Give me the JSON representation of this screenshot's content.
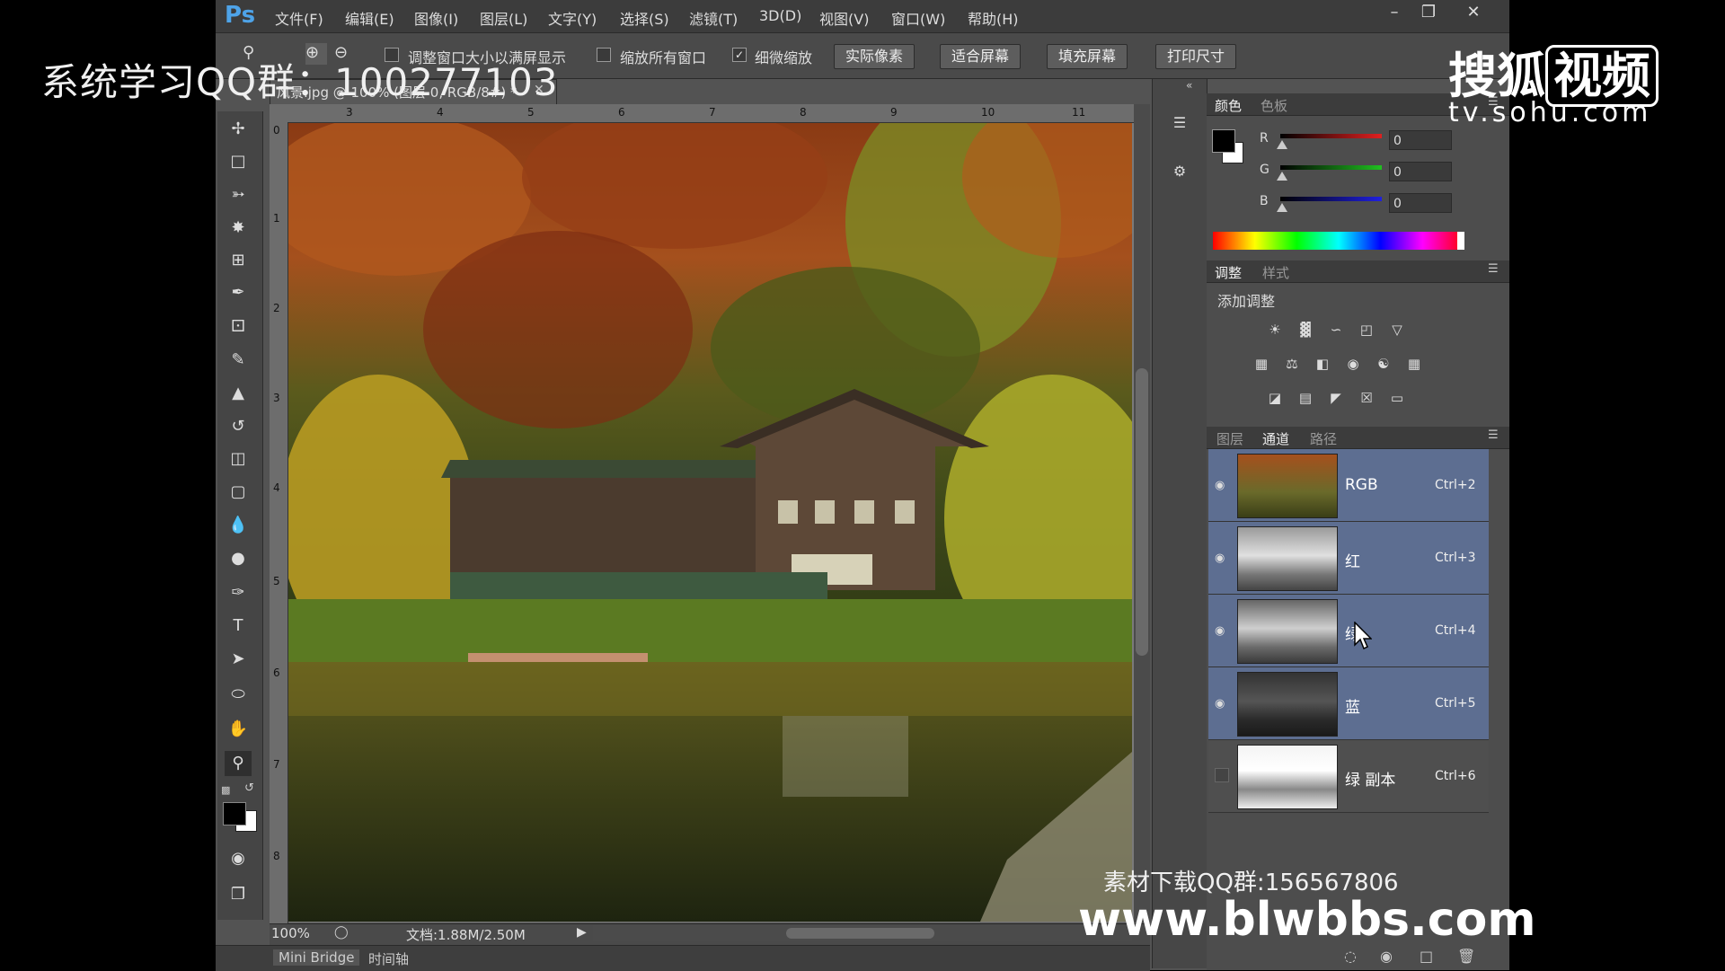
{
  "app": {
    "logo": "Ps",
    "menu": [
      "文件(F)",
      "编辑(E)",
      "图像(I)",
      "图层(L)",
      "文字(Y)",
      "选择(S)",
      "滤镜(T)",
      "3D(D)",
      "视图(V)",
      "窗口(W)",
      "帮助(H)"
    ],
    "window_buttons": [
      "minimize",
      "restore",
      "close"
    ]
  },
  "options_bar": {
    "checkbox_resize": {
      "label": "调整窗口大小以满屏显示",
      "checked": false
    },
    "checkbox_zoom_all": {
      "label": "缩放所有窗口",
      "checked": false
    },
    "checkbox_scrubby": {
      "label": "细微缩放",
      "checked": true
    },
    "buttons": [
      "实际像素",
      "适合屏幕",
      "填充屏幕",
      "打印尺寸"
    ]
  },
  "document": {
    "tab_title": "风景.jpg @ 100% (图层 0, RGB/8#) *",
    "ruler_h": [
      "3",
      "4",
      "5",
      "6",
      "7",
      "8",
      "9",
      "10",
      "11"
    ],
    "ruler_v": [
      "0",
      "1",
      "2",
      "3",
      "4",
      "5",
      "6",
      "7",
      "8"
    ],
    "zoom": "100%",
    "doc_size": "文档:1.88M/2.50M"
  },
  "bottom_tabs": [
    "Mini Bridge",
    "时间轴"
  ],
  "color_panel": {
    "tabs": [
      "颜色",
      "色板"
    ],
    "channels": [
      {
        "label": "R",
        "value": "0",
        "color": "#e02020"
      },
      {
        "label": "G",
        "value": "0",
        "color": "#20c020"
      },
      {
        "label": "B",
        "value": "0",
        "color": "#2020e0"
      }
    ]
  },
  "adjustments_panel": {
    "tabs": [
      "调整",
      "样式"
    ],
    "title": "添加调整",
    "icon_rows": [
      [
        "brightness-icon",
        "levels-icon",
        "curves-icon",
        "exposure-icon",
        "vibrance-icon"
      ],
      [
        "hue-saturation-icon",
        "color-balance-icon",
        "black-white-icon",
        "photo-filter-icon",
        "channel-mixer-icon",
        "color-lookup-icon"
      ],
      [
        "invert-icon",
        "posterize-icon",
        "threshold-icon",
        "selective-color-icon",
        "gradient-map-icon"
      ]
    ]
  },
  "channels_panel": {
    "tabs": [
      "图层",
      "通道",
      "路径"
    ],
    "active_tab": "通道",
    "rows": [
      {
        "name": "RGB",
        "shortcut": "Ctrl+2",
        "visible": true,
        "selected": true
      },
      {
        "name": "红",
        "shortcut": "Ctrl+3",
        "visible": true,
        "selected": true
      },
      {
        "name": "绿",
        "shortcut": "Ctrl+4",
        "visible": true,
        "selected": true
      },
      {
        "name": "蓝",
        "shortcut": "Ctrl+5",
        "visible": true,
        "selected": true
      },
      {
        "name": "绿 副本",
        "shortcut": "Ctrl+6",
        "visible": false,
        "selected": false
      }
    ]
  },
  "watermarks": {
    "left": "系统学习QQ群：100277103",
    "sohu_cn": "搜狐",
    "sohu_box": "视频",
    "sohu_url": "tv.sohu.com",
    "qq_download": "素材下载QQ群:156567806",
    "site": "www.blwbbs.com"
  }
}
